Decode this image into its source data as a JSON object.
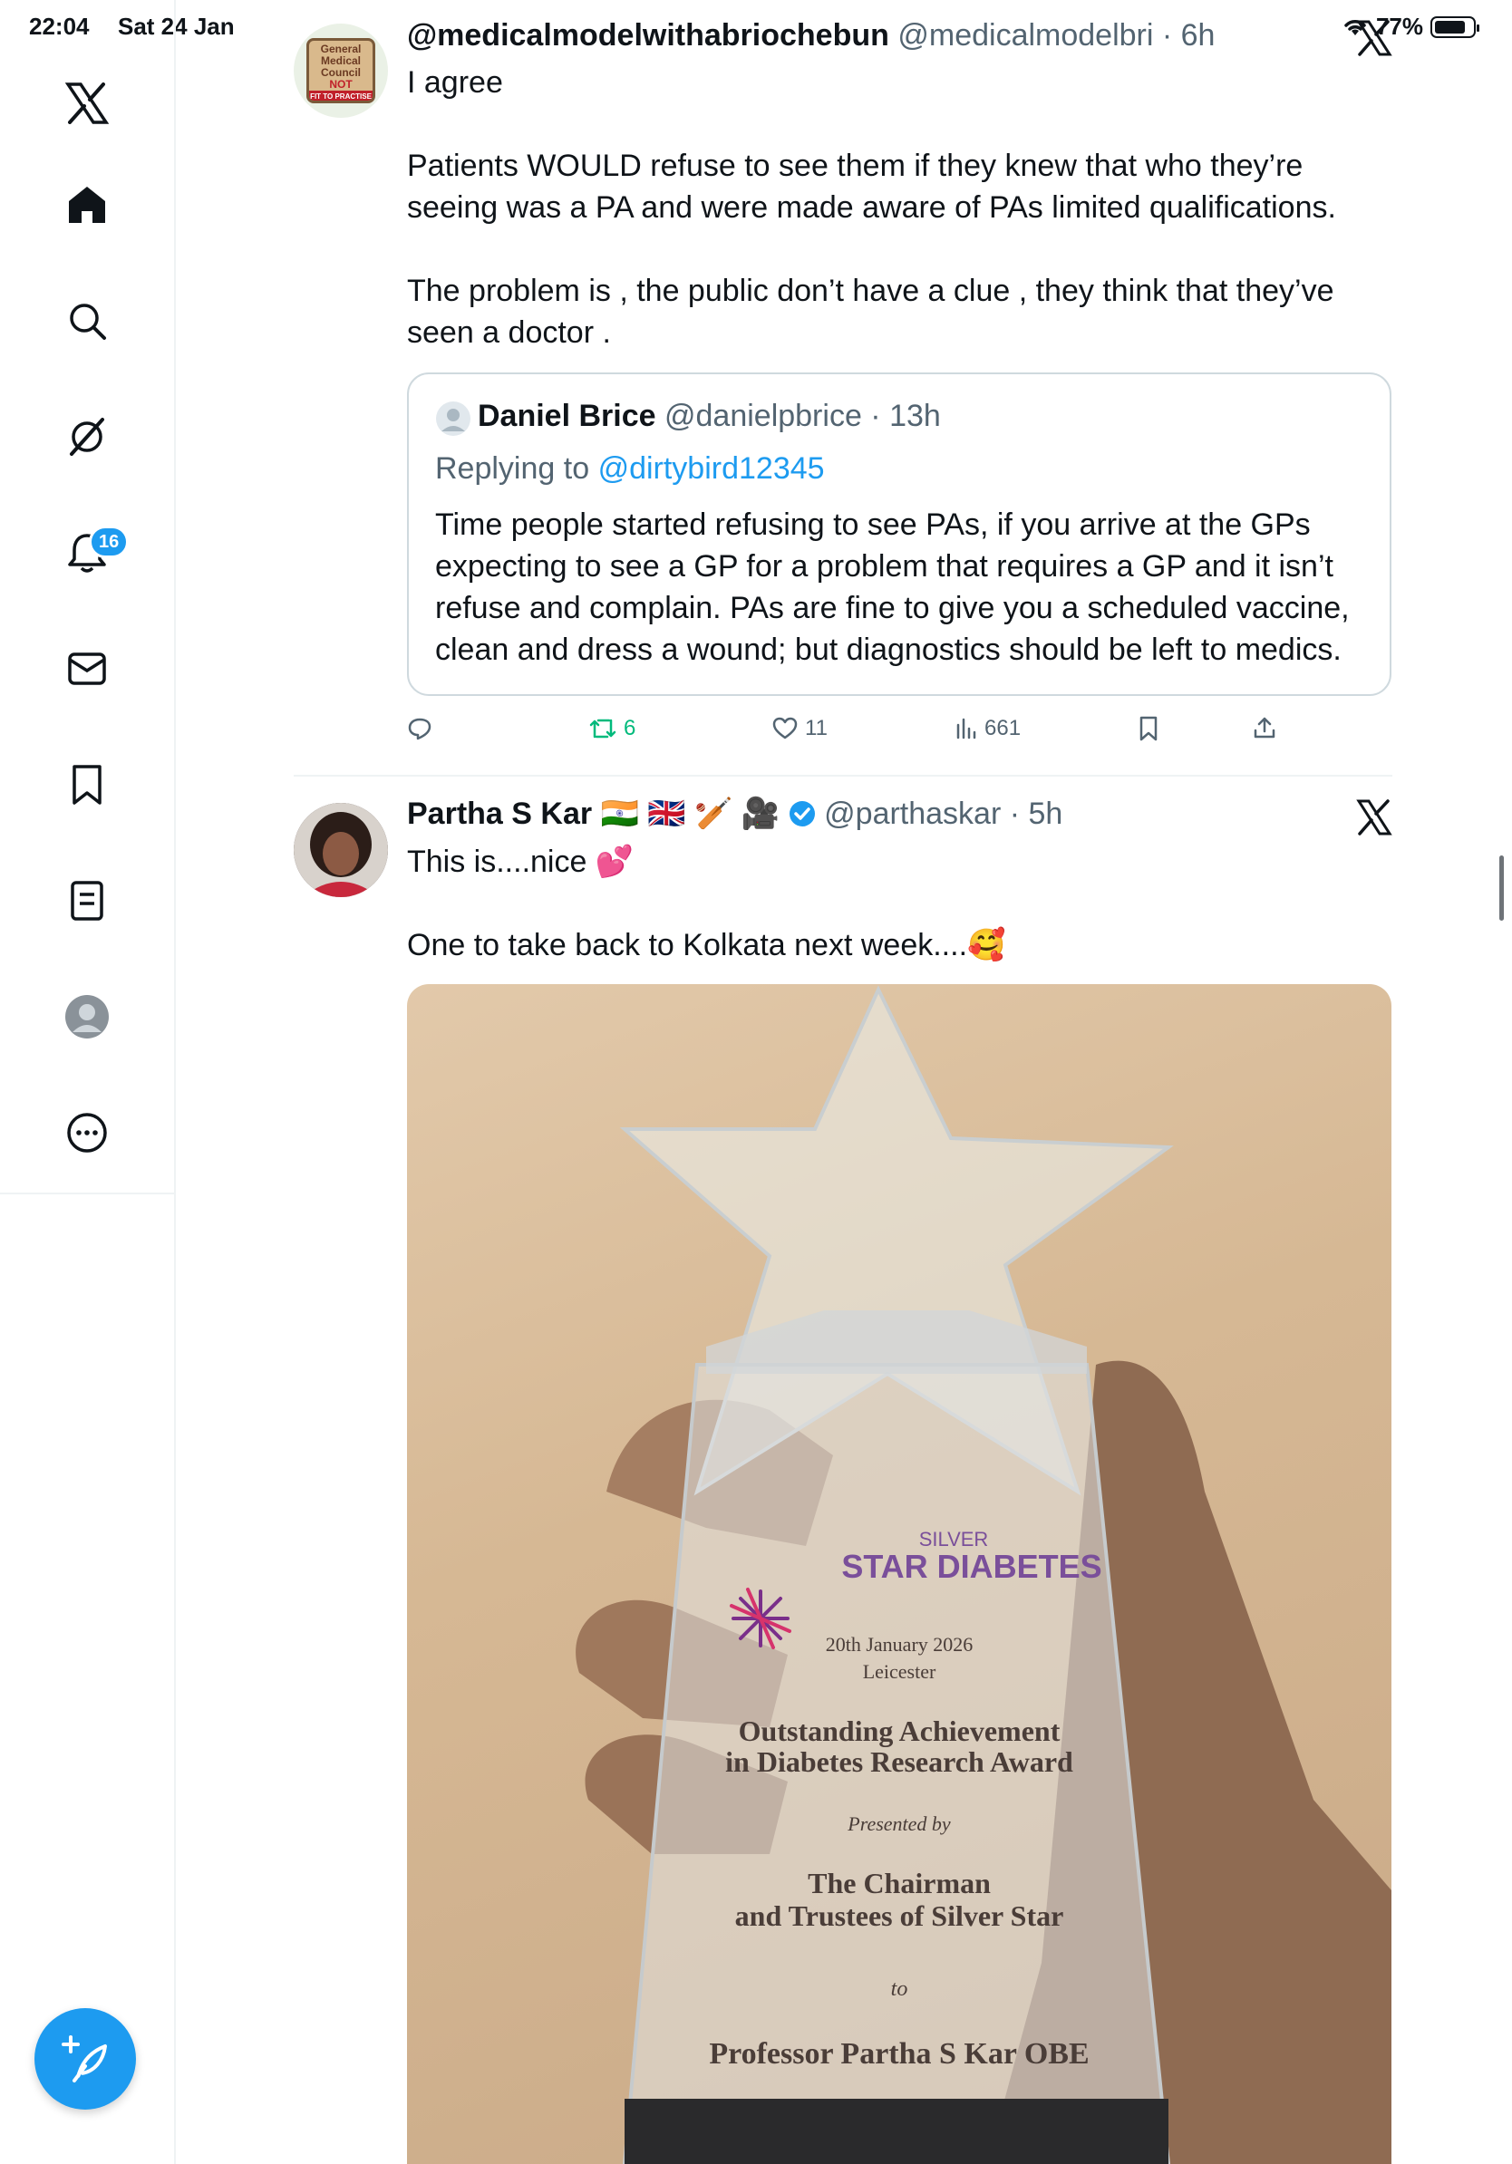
{
  "status_bar": {
    "time": "22:04",
    "date": "Sat 24 Jan",
    "battery": "77%"
  },
  "sidebar": {
    "notifications_badge": "16"
  },
  "tweet1": {
    "display_name": "@medicalmodelwithabriochebun",
    "handle": "@medicalmodelbri",
    "time": "6h",
    "text": [
      "I agree",
      "",
      "Patients WOULD refuse to see them if they knew that who they’re seeing was a PA and were made aware of PAs limited qualifications.",
      "",
      "The problem is , the public don’t have a clue , they think that they’ve seen a doctor ."
    ],
    "avatar_text": [
      "General",
      "Medical",
      "Council",
      "NOT",
      "FIT TO PRACTISE"
    ],
    "quote": {
      "display_name": "Daniel Brice",
      "handle": "@danielpbrice",
      "time": "13h",
      "replying_label": "Replying to",
      "replying_to": "@dirtybird12345",
      "text": "Time people started refusing to see PAs, if you arrive at the GPs expecting to see a GP for a problem that requires a GP and it isn’t refuse and complain. PAs are fine to give you a scheduled vaccine, clean and dress a wound; but diagnostics should be left to medics."
    },
    "actions": {
      "replies": "",
      "retweets": "6",
      "likes": "11",
      "views": "661"
    }
  },
  "tweet2": {
    "display_name": "Partha S Kar",
    "name_emojis": "🇮🇳 🇬🇧 🏏 🎥",
    "handle": "@parthaskar",
    "time": "5h",
    "text_line1": "This is....nice 💕",
    "text_line2": "One to take back to Kolkata next week....🥰",
    "image_text": {
      "brand_top": "SILVER",
      "brand_main": "STAR DIABETES",
      "date": "20th January 2026",
      "place": "Leicester",
      "award_line1": "Outstanding Achievement",
      "award_line2": "in Diabetes Research Award",
      "presented_by": "Presented by",
      "chairman_line1": "The Chairman",
      "chairman_line2": "and Trustees of Silver Star",
      "to": "to",
      "recipient": "Professor Partha S Kar OBE"
    }
  },
  "colors": {
    "accent": "#1d9bf0",
    "retweet": "#00ba7c",
    "text": "#0f1419",
    "muted": "#536471"
  }
}
